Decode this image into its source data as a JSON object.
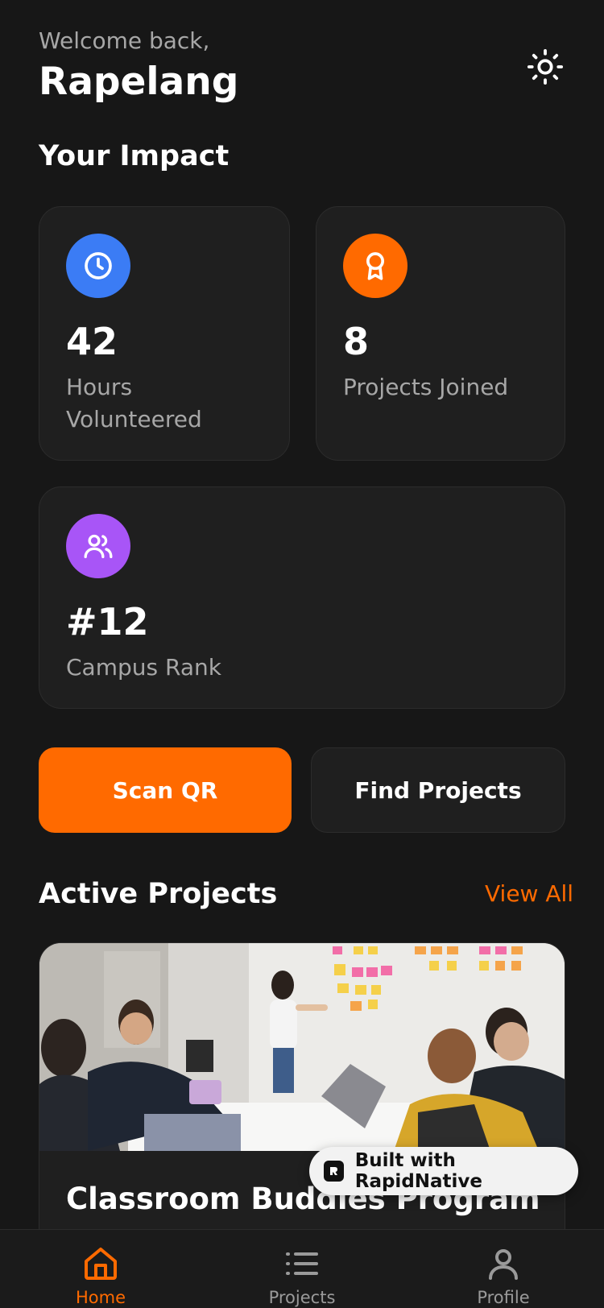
{
  "header": {
    "welcome": "Welcome back,",
    "username": "Rapelang",
    "theme_icon": "sun-icon"
  },
  "impact": {
    "title": "Your Impact",
    "stats": [
      {
        "value": "42",
        "label": "Hours Volunteered",
        "icon": "clock-icon",
        "color": "#3b7cf5"
      },
      {
        "value": "8",
        "label": "Projects Joined",
        "icon": "award-icon",
        "color": "#ff6a00"
      },
      {
        "value": "#12",
        "label": "Campus Rank",
        "icon": "users-icon",
        "color": "#a855f7"
      }
    ]
  },
  "actions": {
    "scan_label": "Scan QR",
    "find_label": "Find Projects"
  },
  "active_projects": {
    "title": "Active Projects",
    "view_all": "View All",
    "projects": [
      {
        "title": "Classroom Buddies Program"
      }
    ]
  },
  "badge": {
    "label": "Built with RapidNative"
  },
  "nav": {
    "items": [
      {
        "label": "Home",
        "icon": "home-icon",
        "active": true
      },
      {
        "label": "Projects",
        "icon": "list-icon",
        "active": false
      },
      {
        "label": "Profile",
        "icon": "user-icon",
        "active": false
      }
    ]
  },
  "colors": {
    "background": "#171717",
    "card": "#1f1f1f",
    "accent": "#ff6a00",
    "muted_text": "#a7a7a7"
  }
}
